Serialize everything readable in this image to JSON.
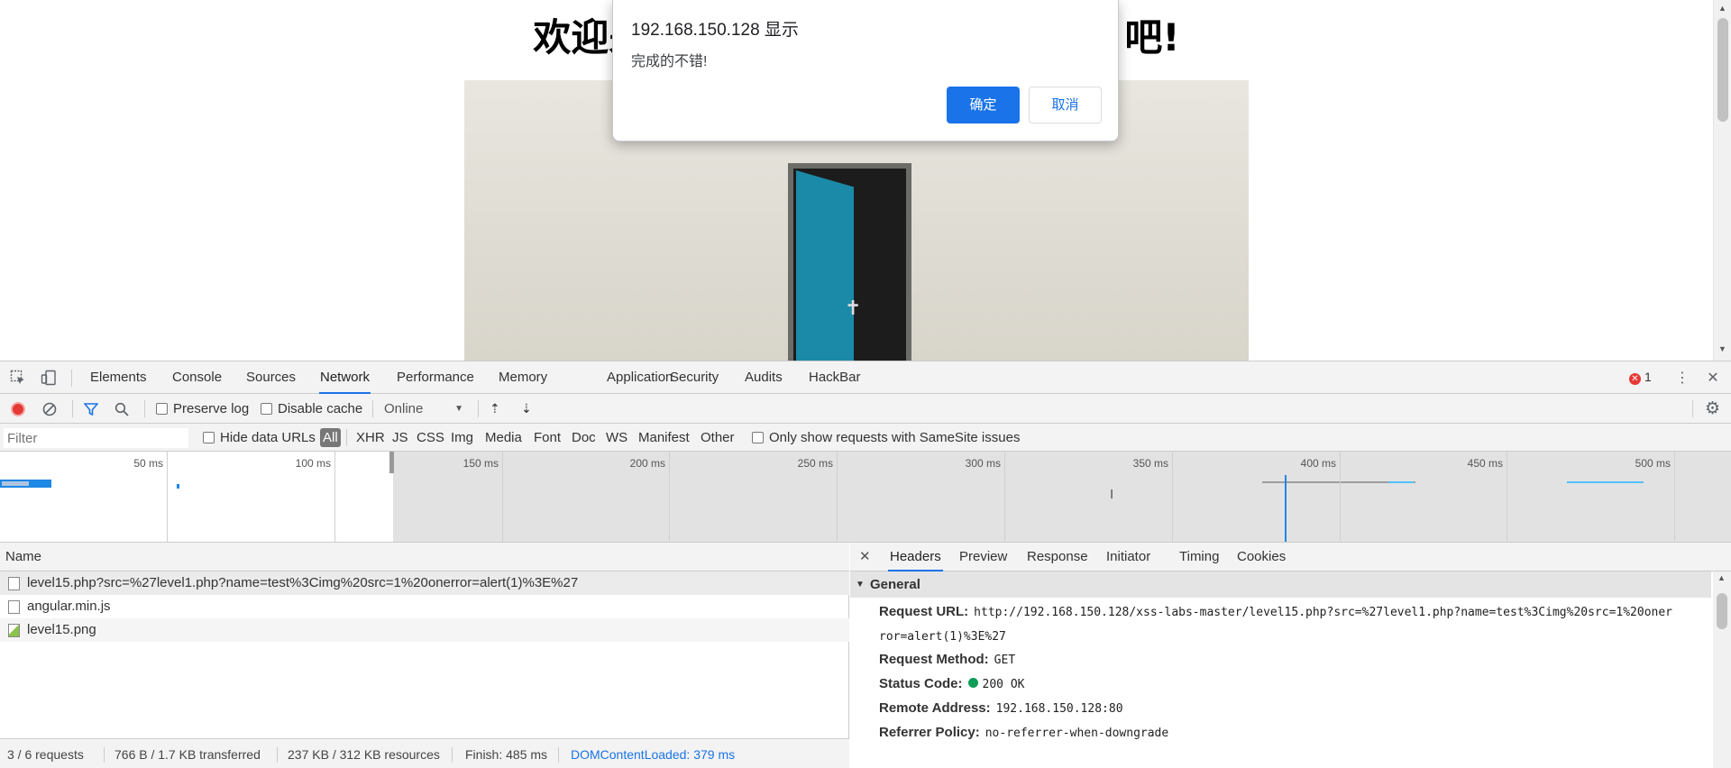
{
  "page": {
    "heading": "欢迎来到level15，不要急，慢慢来吧!",
    "heading_visible_left": "欢迎来",
    "heading_visible_right": "吧!"
  },
  "alert": {
    "title": "192.168.150.128 显示",
    "message": "完成的不错!",
    "ok_label": "确定",
    "cancel_label": "取消"
  },
  "devtools": {
    "tabs": [
      "Elements",
      "Console",
      "Sources",
      "Network",
      "Performance",
      "Memory",
      "Application",
      "Security",
      "Audits",
      "HackBar"
    ],
    "active_tab": "Network",
    "error_count": "1",
    "toolbar": {
      "preserve_log": "Preserve log",
      "disable_cache": "Disable cache",
      "throttle": "Online"
    },
    "filter": {
      "placeholder": "Filter",
      "hide_data_urls": "Hide data URLs",
      "types": [
        "All",
        "XHR",
        "JS",
        "CSS",
        "Img",
        "Media",
        "Font",
        "Doc",
        "WS",
        "Manifest",
        "Other"
      ],
      "samesite": "Only show requests with SameSite issues"
    },
    "timeline": {
      "ticks": [
        "50 ms",
        "100 ms",
        "150 ms",
        "200 ms",
        "250 ms",
        "300 ms",
        "350 ms",
        "400 ms",
        "450 ms",
        "500 ms"
      ]
    },
    "requests": {
      "header": "Name",
      "rows": [
        "level15.php?src=%27level1.php?name=test%3Cimg%20src=1%20onerror=alert(1)%3E%27",
        "angular.min.js",
        "level15.png"
      ]
    },
    "detail": {
      "tabs": [
        "Headers",
        "Preview",
        "Response",
        "Initiator",
        "Timing",
        "Cookies"
      ],
      "active_tab": "Headers",
      "section": "General",
      "request_url_key": "Request URL:",
      "request_url": "http://192.168.150.128/xss-labs-master/level15.php?src=%27level1.php?name=test%3Cimg%20src=1%20oner",
      "request_url_wrap": "ror=alert(1)%3E%27",
      "method_key": "Request Method:",
      "method": "GET",
      "status_key": "Status Code:",
      "status": "200 OK",
      "remote_key": "Remote Address:",
      "remote": "192.168.150.128:80",
      "referrer_key": "Referrer Policy:",
      "referrer": "no-referrer-when-downgrade"
    },
    "status_bar": {
      "requests": "3 / 6 requests",
      "transferred": "766 B / 1.7 KB transferred",
      "resources": "237 KB / 312 KB resources",
      "finish": "Finish: 485 ms",
      "dcl": "DOMContentLoaded: 379 ms"
    },
    "colors": {
      "accent": "#1a73e8",
      "record": "#e53935",
      "status_ok": "#0f9d58",
      "dcl": "#1a73e8"
    }
  }
}
